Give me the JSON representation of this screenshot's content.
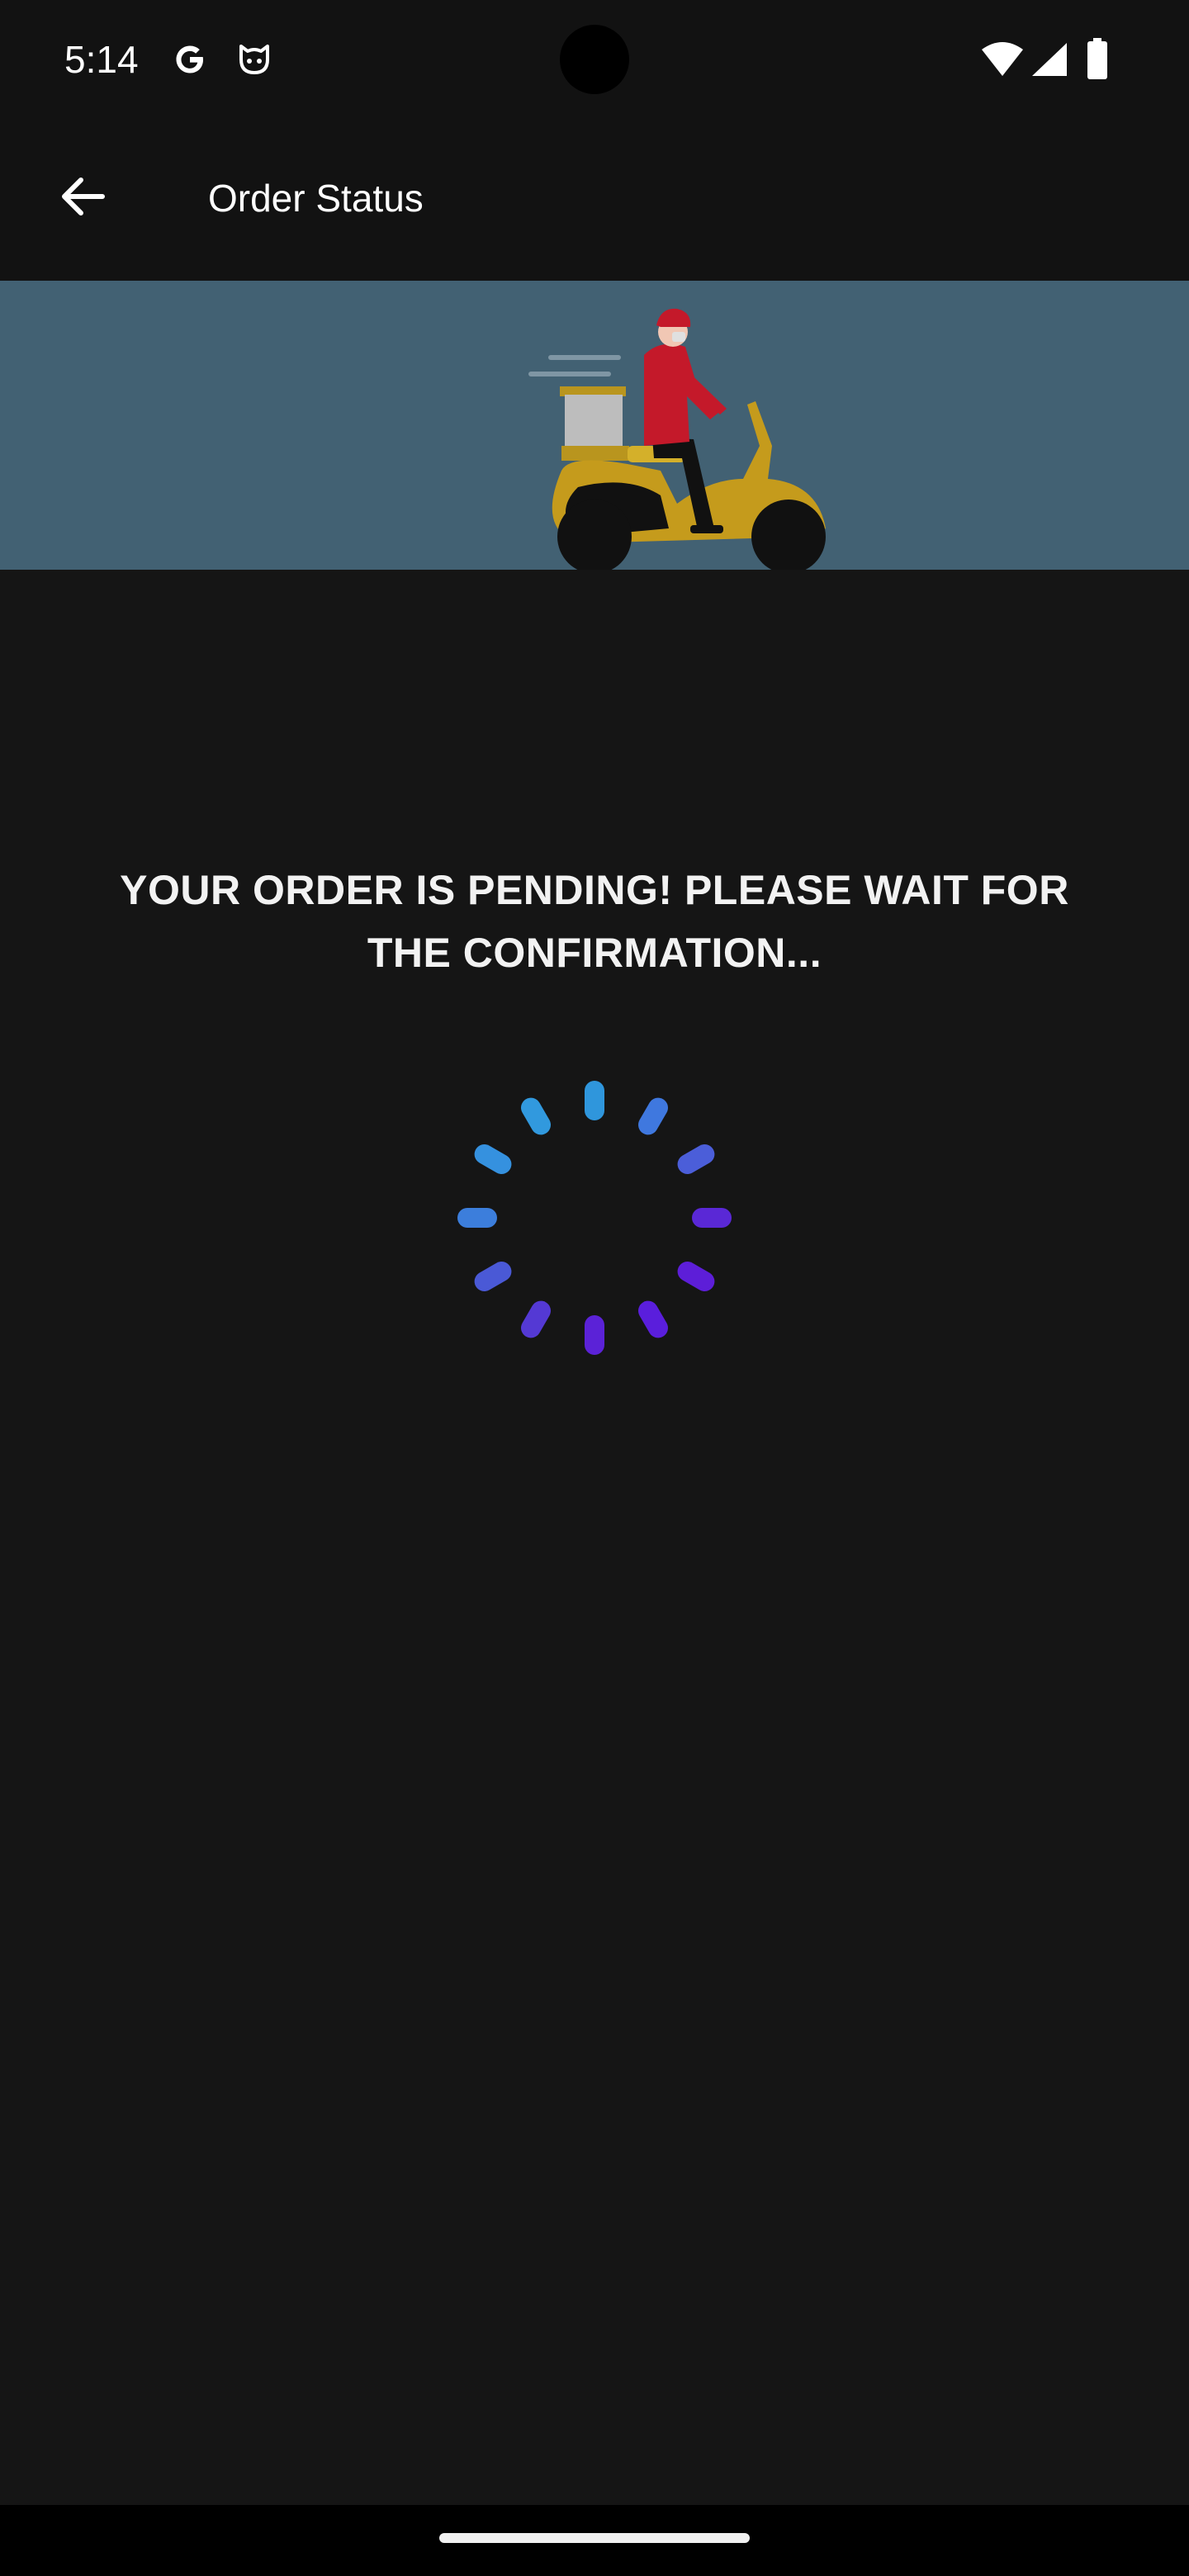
{
  "status_bar": {
    "time": "5:14",
    "icons": [
      "google-icon",
      "cat-icon",
      "wifi-icon",
      "signal-icon",
      "battery-icon"
    ]
  },
  "app_bar": {
    "title": "Order Status",
    "back_icon": "arrow-left-icon"
  },
  "banner": {
    "illustration": "delivery-scooter-illustration",
    "background_color": "#426173"
  },
  "main": {
    "message": "YOUR ORDER IS PENDING! PLEASE WAIT FOR THE CONFIRMATION...",
    "spinner_icon": "loading-spinner-icon"
  },
  "colors": {
    "background": "#151515",
    "spinner_start": "#2f9ae0",
    "spinner_end": "#5a18d8"
  }
}
